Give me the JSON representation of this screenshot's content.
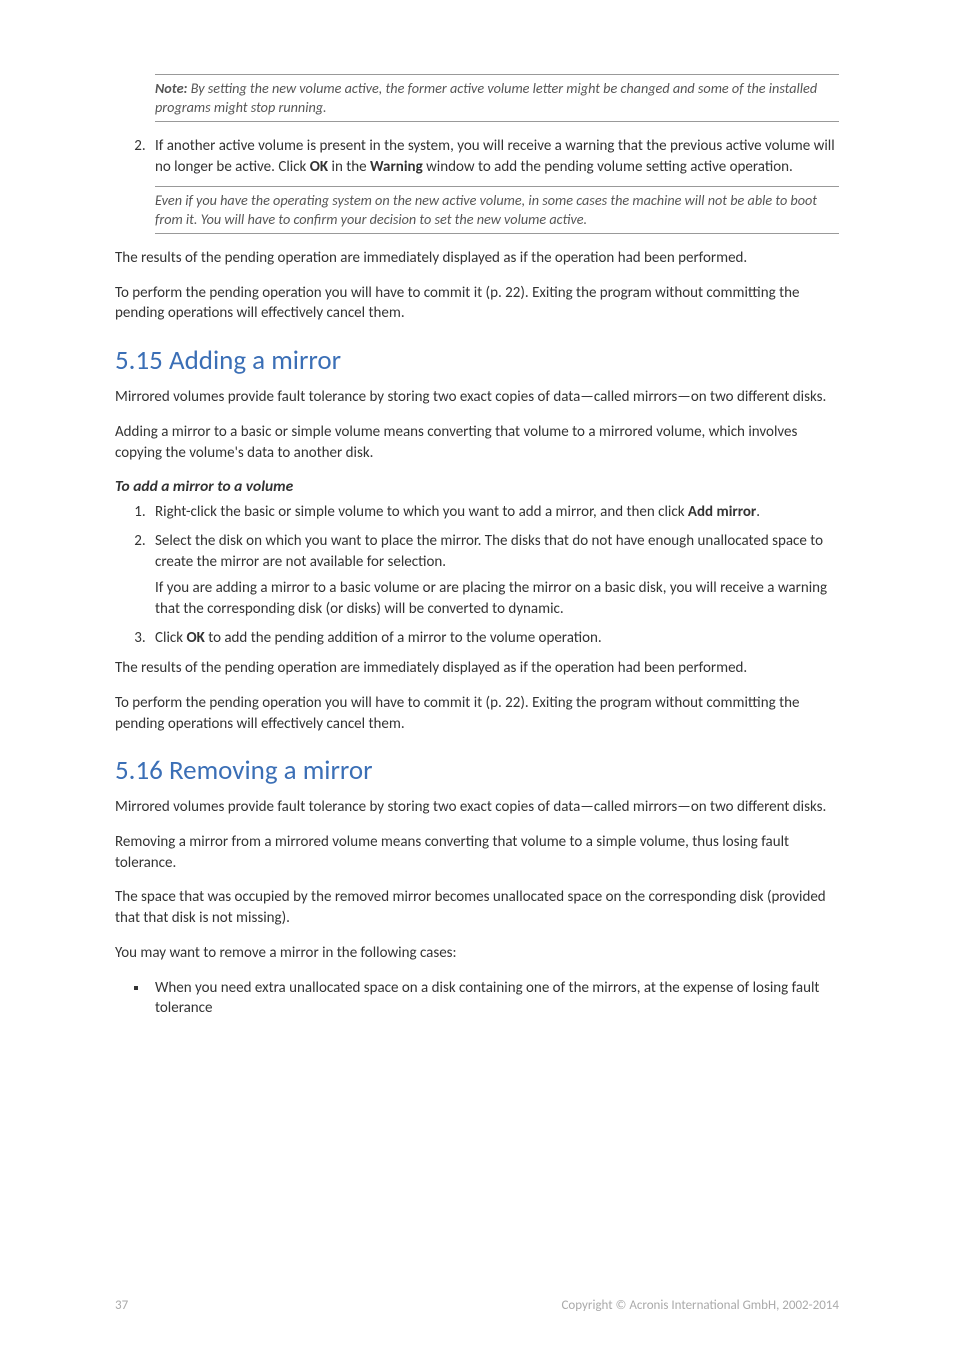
{
  "note1": {
    "label": "Note:",
    "text": " By setting the new volume active, the former active volume letter might be changed and some of the installed programs might stop running."
  },
  "list_top": {
    "item2_a": "If another active volume is present in the system, you will receive a warning that the previous active volume will no longer be active. Click ",
    "item2_ok": "OK",
    "item2_b": " in the ",
    "item2_warning": "Warning",
    "item2_c": " window to add the pending volume setting active operation.",
    "item2_note": "Even if you have the operating system on the new active volume, in some cases the machine will not be able to boot from it. You will have to confirm your decision to set the new volume active."
  },
  "para_results": "The results of the pending operation are immediately displayed as if the operation had been performed.",
  "para_perform": "To perform the pending operation you will have to commit it (p. 22). Exiting the program without committing the pending operations will effectively cancel them.",
  "sec515": {
    "title": "5.15 Adding a mirror",
    "p1": "Mirrored volumes provide fault tolerance by storing two exact copies of data—called mirrors—on two different disks.",
    "p2": "Adding a mirror to a basic or simple volume means converting that volume to a mirrored volume, which involves copying the volume's data to another disk.",
    "subhead": "To add a mirror to a volume",
    "li1_a": "Right-click the basic or simple volume to which you want to add a mirror, and then click ",
    "li1_add": "Add mirror",
    "li1_b": ".",
    "li2_a": "Select the disk on which you want to place the mirror. The disks that do not have enough unallocated space to create the mirror are not available for selection.",
    "li2_sub": "If you are adding a mirror to a basic volume or are placing the mirror on a basic disk, you will receive a warning that the corresponding disk (or disks) will be converted to dynamic.",
    "li3_a": "Click ",
    "li3_ok": "OK",
    "li3_b": " to add the pending addition of a mirror to the volume operation."
  },
  "sec516": {
    "title": "5.16 Removing a mirror",
    "p1": "Mirrored volumes provide fault tolerance by storing two exact copies of data—called mirrors—on two different disks.",
    "p2": "Removing a mirror from a mirrored volume means converting that volume to a simple volume, thus losing fault tolerance.",
    "p3": "The space that was occupied by the removed mirror becomes unallocated space on the corresponding disk (provided that that disk is not missing).",
    "p4": "You may want to remove a mirror in the following cases:",
    "b1": "When you need extra unallocated space on a disk containing one of the mirrors, at the expense of losing fault tolerance"
  },
  "footer": {
    "page": "37",
    "copyright": "Copyright © Acronis International GmbH, 2002-2014"
  }
}
